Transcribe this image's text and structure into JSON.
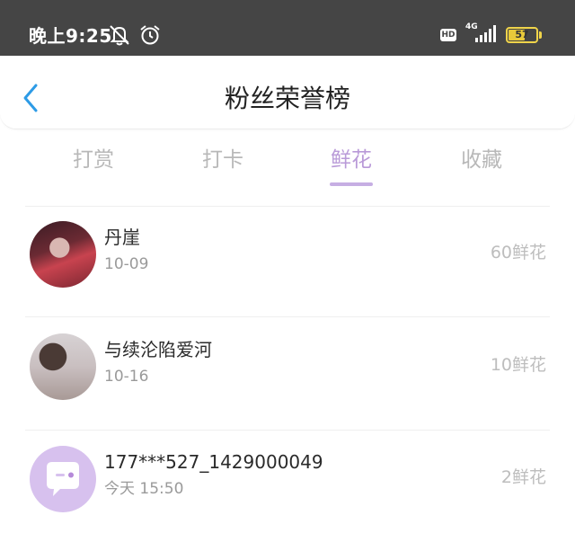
{
  "status_bar": {
    "time": "晚上9:25",
    "hd": "HD",
    "network": "4G",
    "battery_level": "57",
    "battery_fraction": 0.57,
    "icons": [
      "mute-icon",
      "alarm-icon",
      "signal-icon",
      "battery-icon"
    ]
  },
  "header": {
    "title": "粉丝荣誉榜",
    "back_icon": "chevron-left-icon"
  },
  "tabs": [
    {
      "label": "打赏",
      "active": false
    },
    {
      "label": "打卡",
      "active": false
    },
    {
      "label": "鲜花",
      "active": true
    },
    {
      "label": "收藏",
      "active": false
    }
  ],
  "list": [
    {
      "name": "丹崖",
      "date": "10-09",
      "amount": "60鲜花"
    },
    {
      "name": "与续沦陷爱河",
      "date": "10-16",
      "amount": "10鲜花"
    },
    {
      "name": "177***527_1429000049",
      "date": "今天 15:50",
      "amount": "2鲜花"
    }
  ],
  "colors": {
    "status_bar_bg": "#454545",
    "accent": "#b99ad8",
    "back_icon": "#2d9be6",
    "default_avatar_bg": "#d7c1ee"
  }
}
